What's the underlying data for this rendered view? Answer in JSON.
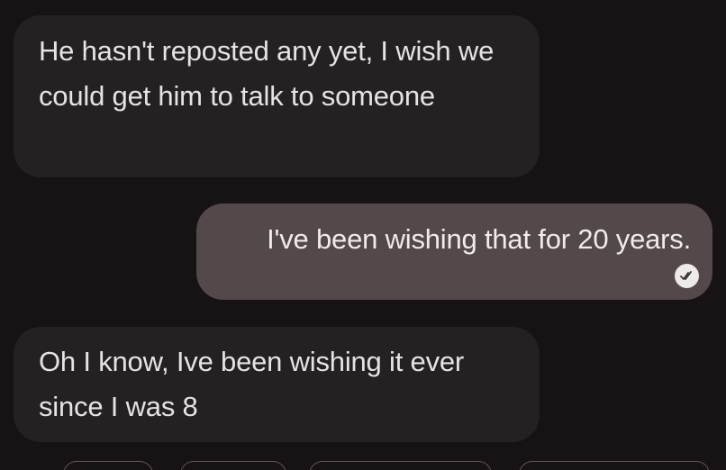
{
  "messages": [
    {
      "direction": "incoming",
      "text": "He hasn't reposted any yet, I wish we could get him to talk to someone"
    },
    {
      "direction": "outgoing",
      "text": "I've been wishing that for 20 years.",
      "status": "read"
    },
    {
      "direction": "incoming",
      "text": "Oh I know, Ive been wishing it ever since I was 8"
    }
  ],
  "receipt_icon": "double-check-icon",
  "suggestion_chips": [
    {
      "label": ""
    },
    {
      "label": ""
    },
    {
      "label": ""
    },
    {
      "label": ""
    }
  ],
  "colors": {
    "background": "#171213",
    "incoming_bubble": "#232122",
    "outgoing_bubble": "#53484a",
    "text": "#e8e2e2"
  }
}
